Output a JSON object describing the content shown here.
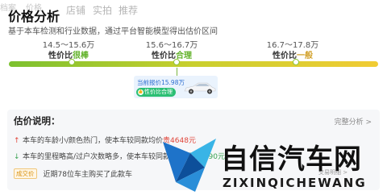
{
  "tabs": [
    "档案",
    "价格",
    "店铺",
    "实拍",
    "推荐"
  ],
  "header": {
    "title": "价格分析",
    "description": "基于本车检测和行业数据，通过平台智能模型得出估价区间"
  },
  "price_ranges": [
    {
      "range": "14.5～15.6万",
      "label_prefix": "性价比",
      "label_level": "很棒",
      "color": "#62b22a"
    },
    {
      "range": "15.6～16.7万",
      "label_prefix": "性价比",
      "label_level": "合理",
      "color": "#62b22a"
    },
    {
      "range": "16.7～17.8万",
      "label_prefix": "性价比",
      "label_level": "一般",
      "color": "#d2a12a"
    }
  ],
  "current_quote": {
    "text": "当前报价15.98万",
    "badge": "性价比合理",
    "badge_icon": "thumbs-up-icon"
  },
  "analysis": {
    "title": "估价说明：",
    "full_link": "完整分析 >",
    "reasons": [
      {
        "direction": "up",
        "icon": "arrow-up-icon",
        "text": "本车的车龄小/颜色热门，使本车较同款均价",
        "highlight": "贵4648元",
        "highlight_color": "#e0453a"
      },
      {
        "direction": "down",
        "icon": "arrow-down-icon",
        "text": "本车的里程略高/过户次数略多，使本车较同款均价",
        "highlight": "便宜1590元",
        "highlight_color": "#3aa352"
      }
    ],
    "deal_tag": "成交价",
    "deal_text": "近期78位车主购买了此款车",
    "fine_print": "交易明细 >"
  },
  "watermark": {
    "title": "自信汽车网",
    "subtitle": "ZIXINQICHEWANG"
  }
}
